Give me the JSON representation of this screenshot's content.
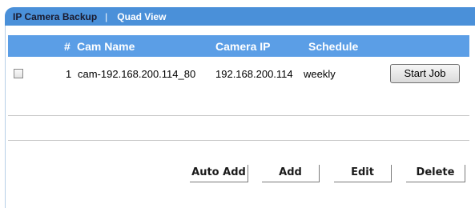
{
  "tabs": {
    "active": "IP Camera Backup",
    "separator": "|",
    "inactive": "Quad View"
  },
  "table": {
    "headers": [
      "#",
      "Cam Name",
      "Camera IP",
      "Schedule"
    ],
    "rows": [
      {
        "checked": false,
        "index": "1",
        "cam_name": "cam-192.168.200.114_80",
        "camera_ip": "192.168.200.114",
        "schedule": "weekly",
        "action_label": "Start Job"
      }
    ]
  },
  "actions": {
    "auto_add": "Auto Add",
    "add": "Add",
    "edit": "Edit",
    "delete": "Delete"
  },
  "colors": {
    "tab_bar": "#4a90d9",
    "table_header": "#5b9ee6"
  }
}
